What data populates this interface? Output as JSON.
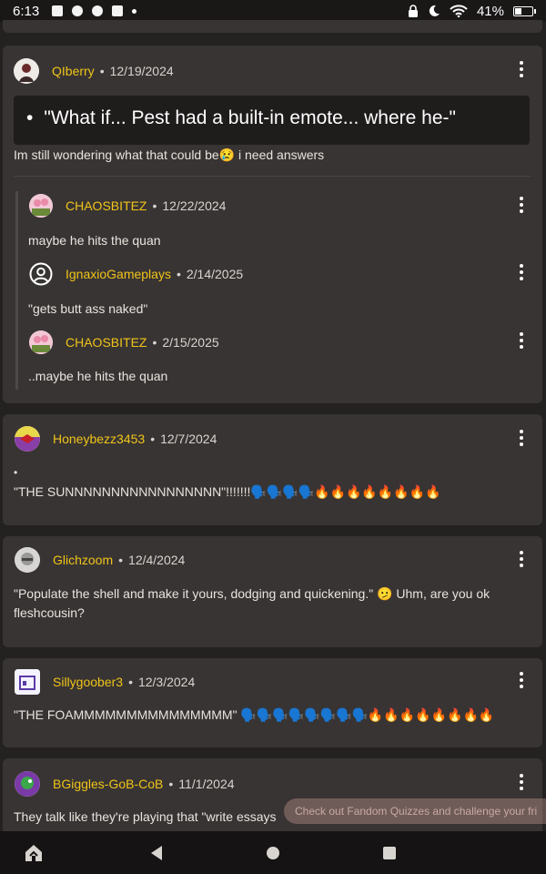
{
  "status_bar": {
    "time": "6:13",
    "battery": "41%",
    "battery_level": 0.41,
    "icons": [
      "gallery-icon",
      "timer-icon",
      "chat-icon",
      "book-icon",
      "dot-icon",
      "lock-icon",
      "moon-icon",
      "wifi-icon",
      "battery-icon"
    ]
  },
  "comments": [
    {
      "username": "QIberry",
      "date": "12/19/2024",
      "quote": "\"What if... Pest had a built-in emote... where he-\"",
      "quote_bullet": "•",
      "text": "Im still wondering what that could be😢 i need answers",
      "replies": [
        {
          "username": "CHAOSBITEZ",
          "date": "12/22/2024",
          "text": "maybe he hits the quan"
        },
        {
          "username": "IgnaxioGameplays",
          "date": "2/14/2025",
          "text": "\"gets butt ass naked\""
        },
        {
          "username": "CHAOSBITEZ",
          "date": "2/15/2025",
          "text": "..maybe he hits the quan"
        }
      ]
    },
    {
      "username": "Honeybezz3453",
      "date": "12/7/2024",
      "bullet": "•",
      "text": "\"THE SUNNNNNNNNNNNNNNNNN\"!!!!!!!🗣️🗣️🗣️🗣️🔥🔥🔥🔥🔥🔥🔥🔥"
    },
    {
      "username": "Glichzoom",
      "date": "12/4/2024",
      "text": "\"Populate the shell and make it yours, dodging and quickening.\" 🫤 Uhm, are you ok fleshcousin?"
    },
    {
      "username": "Sillygoober3",
      "date": "12/3/2024",
      "text": "\"THE FOAMMMMMMMMMMMMMMM\" 🗣️🗣️🗣️🗣️🗣️🗣️🗣️🗣️🔥🔥🔥🔥🔥🔥🔥🔥"
    },
    {
      "username": "BGiggles-GoB-CoB",
      "date": "11/1/2024",
      "text": "They talk like they're playing that \"write essays"
    }
  ],
  "toast": "Check out Fandom Quizzes and challenge your fri",
  "separator": "•",
  "colors": {
    "username": "#f0c419",
    "card": "#383433",
    "background": "#242121"
  }
}
